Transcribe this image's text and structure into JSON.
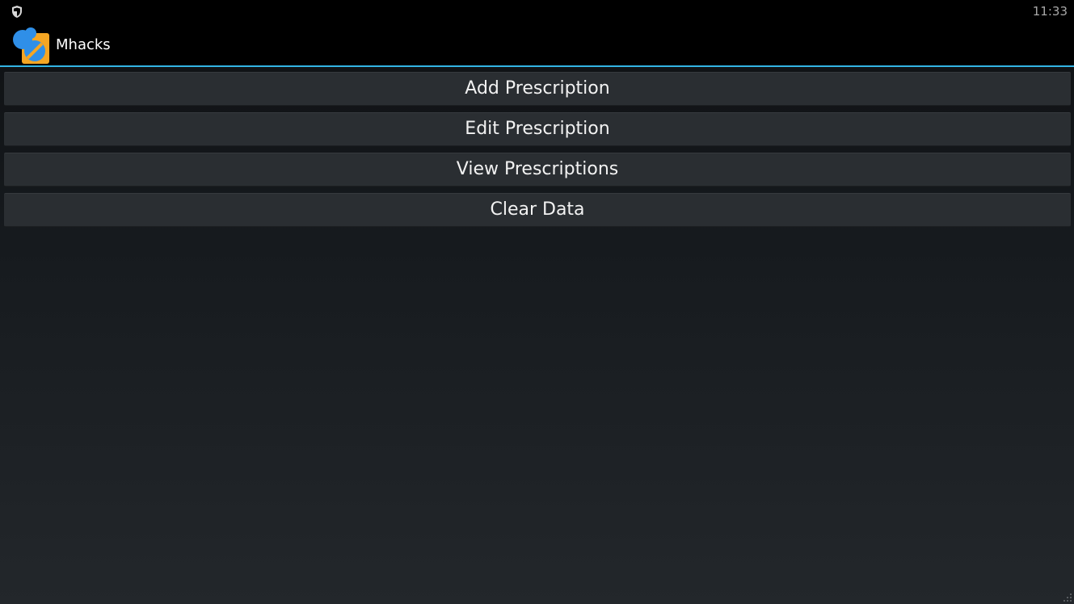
{
  "status_bar": {
    "time": "11:33",
    "notification_icon": "shield-icon"
  },
  "action_bar": {
    "app_icon": "pill-bottle-icon",
    "title": "Mhacks",
    "accent_color": "#33b5e5"
  },
  "menu": {
    "buttons": [
      {
        "label": "Add Prescription"
      },
      {
        "label": "Edit Prescription"
      },
      {
        "label": "View Prescriptions"
      },
      {
        "label": "Clear Data"
      }
    ]
  },
  "colors": {
    "button_bg": "#2a2e32",
    "text": "#f2f2f2",
    "icon_orange": "#f5a623",
    "icon_blue": "#2f8fe8"
  }
}
